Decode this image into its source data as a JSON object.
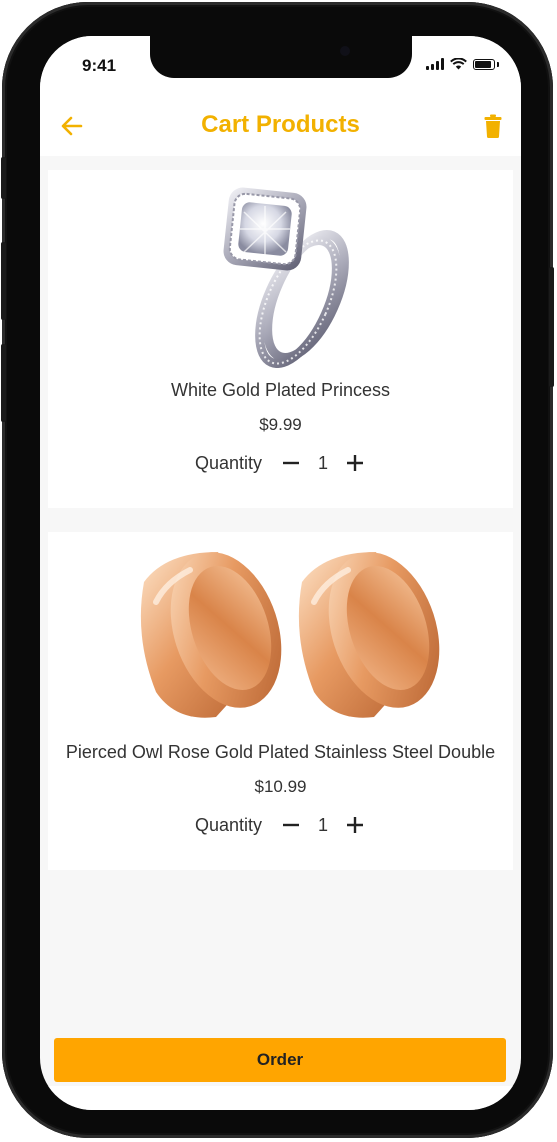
{
  "status_bar": {
    "time": "9:41"
  },
  "header": {
    "title": "Cart Products",
    "back_icon": "arrow-left-icon",
    "delete_icon": "trash-icon",
    "accent_color": "#f2b100"
  },
  "products": [
    {
      "name": "White Gold Plated Princess",
      "price": "$9.99",
      "quantity_label": "Quantity",
      "quantity": "1",
      "decrement_symbol": "−",
      "increment_symbol": "+",
      "image": "ring-product-image"
    },
    {
      "name": "Pierced Owl Rose Gold Plated Stainless Steel Double",
      "price": "$10.99",
      "quantity_label": "Quantity",
      "quantity": "1",
      "decrement_symbol": "−",
      "increment_symbol": "+",
      "image": "ear-plugs-product-image"
    }
  ],
  "order_button": {
    "label": "Order",
    "color": "#ffa500"
  }
}
